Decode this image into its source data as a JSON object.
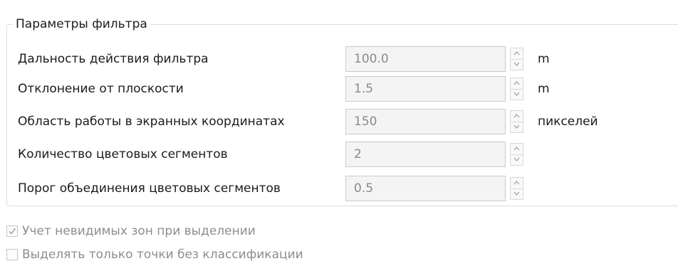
{
  "group": {
    "title": "Параметры фильтра"
  },
  "fields": [
    {
      "label": "Дальность действия фильтра",
      "value": "100.0",
      "unit": "m"
    },
    {
      "label": "Отклонение от плоскости",
      "value": "1.5",
      "unit": "m"
    },
    {
      "label": "Область работы в экранных координатах",
      "value": "150",
      "unit": "пикселей"
    },
    {
      "label": "Количество цветовых сегментов",
      "value": "2",
      "unit": ""
    },
    {
      "label": "Порог объединения цветовых сегментов",
      "value": "0.5",
      "unit": ""
    }
  ],
  "checkboxes": [
    {
      "label": "Учет невидимых зон при выделении",
      "checked": true,
      "enabled": false
    },
    {
      "label": "Выделять только точки без классификации",
      "checked": false,
      "enabled": false
    }
  ],
  "colors": {
    "disabled_text": "#8a8a8a",
    "field_background": "#f4f4f4",
    "group_border": "#d5dfe5"
  },
  "icons": {
    "spin_up": "chevron-up-icon",
    "spin_down": "chevron-down-icon",
    "check": "checkmark-icon"
  }
}
